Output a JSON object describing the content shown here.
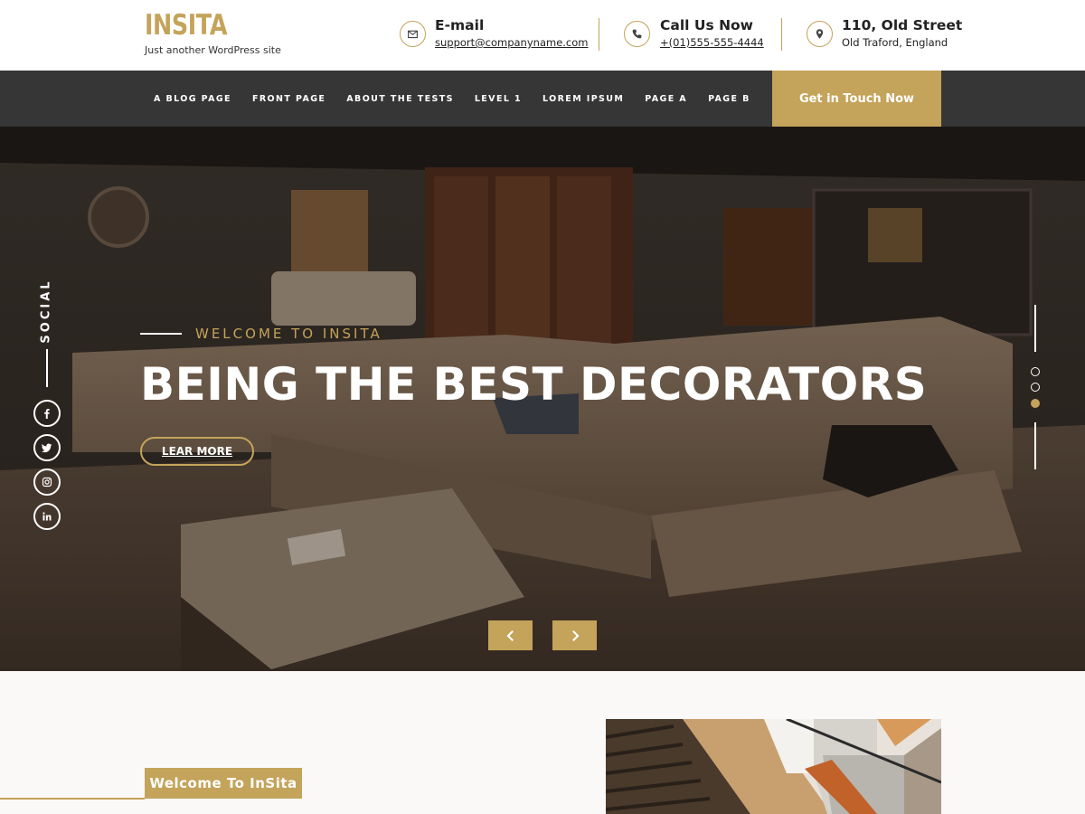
{
  "colors": {
    "accent": "#c4a35a",
    "nav_bg": "#363636",
    "dark_text": "#222222"
  },
  "site": {
    "logo": "INSITA",
    "tagline": "Just another WordPress site"
  },
  "contacts": [
    {
      "icon": "envelope-icon",
      "title": "E-mail",
      "value": "support@companyname.com"
    },
    {
      "icon": "phone-icon",
      "title": "Call Us Now",
      "value": "+(01)555-555-4444"
    },
    {
      "icon": "map-pin-icon",
      "title": "110, Old Street",
      "value": "Old Traford, England"
    }
  ],
  "nav": {
    "items": [
      "A BLOG PAGE",
      "FRONT PAGE",
      "ABOUT THE TESTS",
      "LEVEL 1",
      "LOREM IPSUM",
      "PAGE A",
      "PAGE B"
    ],
    "cta": "Get in Touch Now"
  },
  "hero": {
    "welcome": "WELCOME TO INSITA",
    "headline": "BEING THE BEST DECORATORS",
    "button": "LEAR MORE",
    "social_label": "SOCIAL",
    "social_icons": [
      "facebook-icon",
      "twitter-icon",
      "instagram-icon",
      "linkedin-icon"
    ],
    "slides_total": 3,
    "active_slide": 3
  },
  "about": {
    "heading": "Welcome To InSita"
  }
}
